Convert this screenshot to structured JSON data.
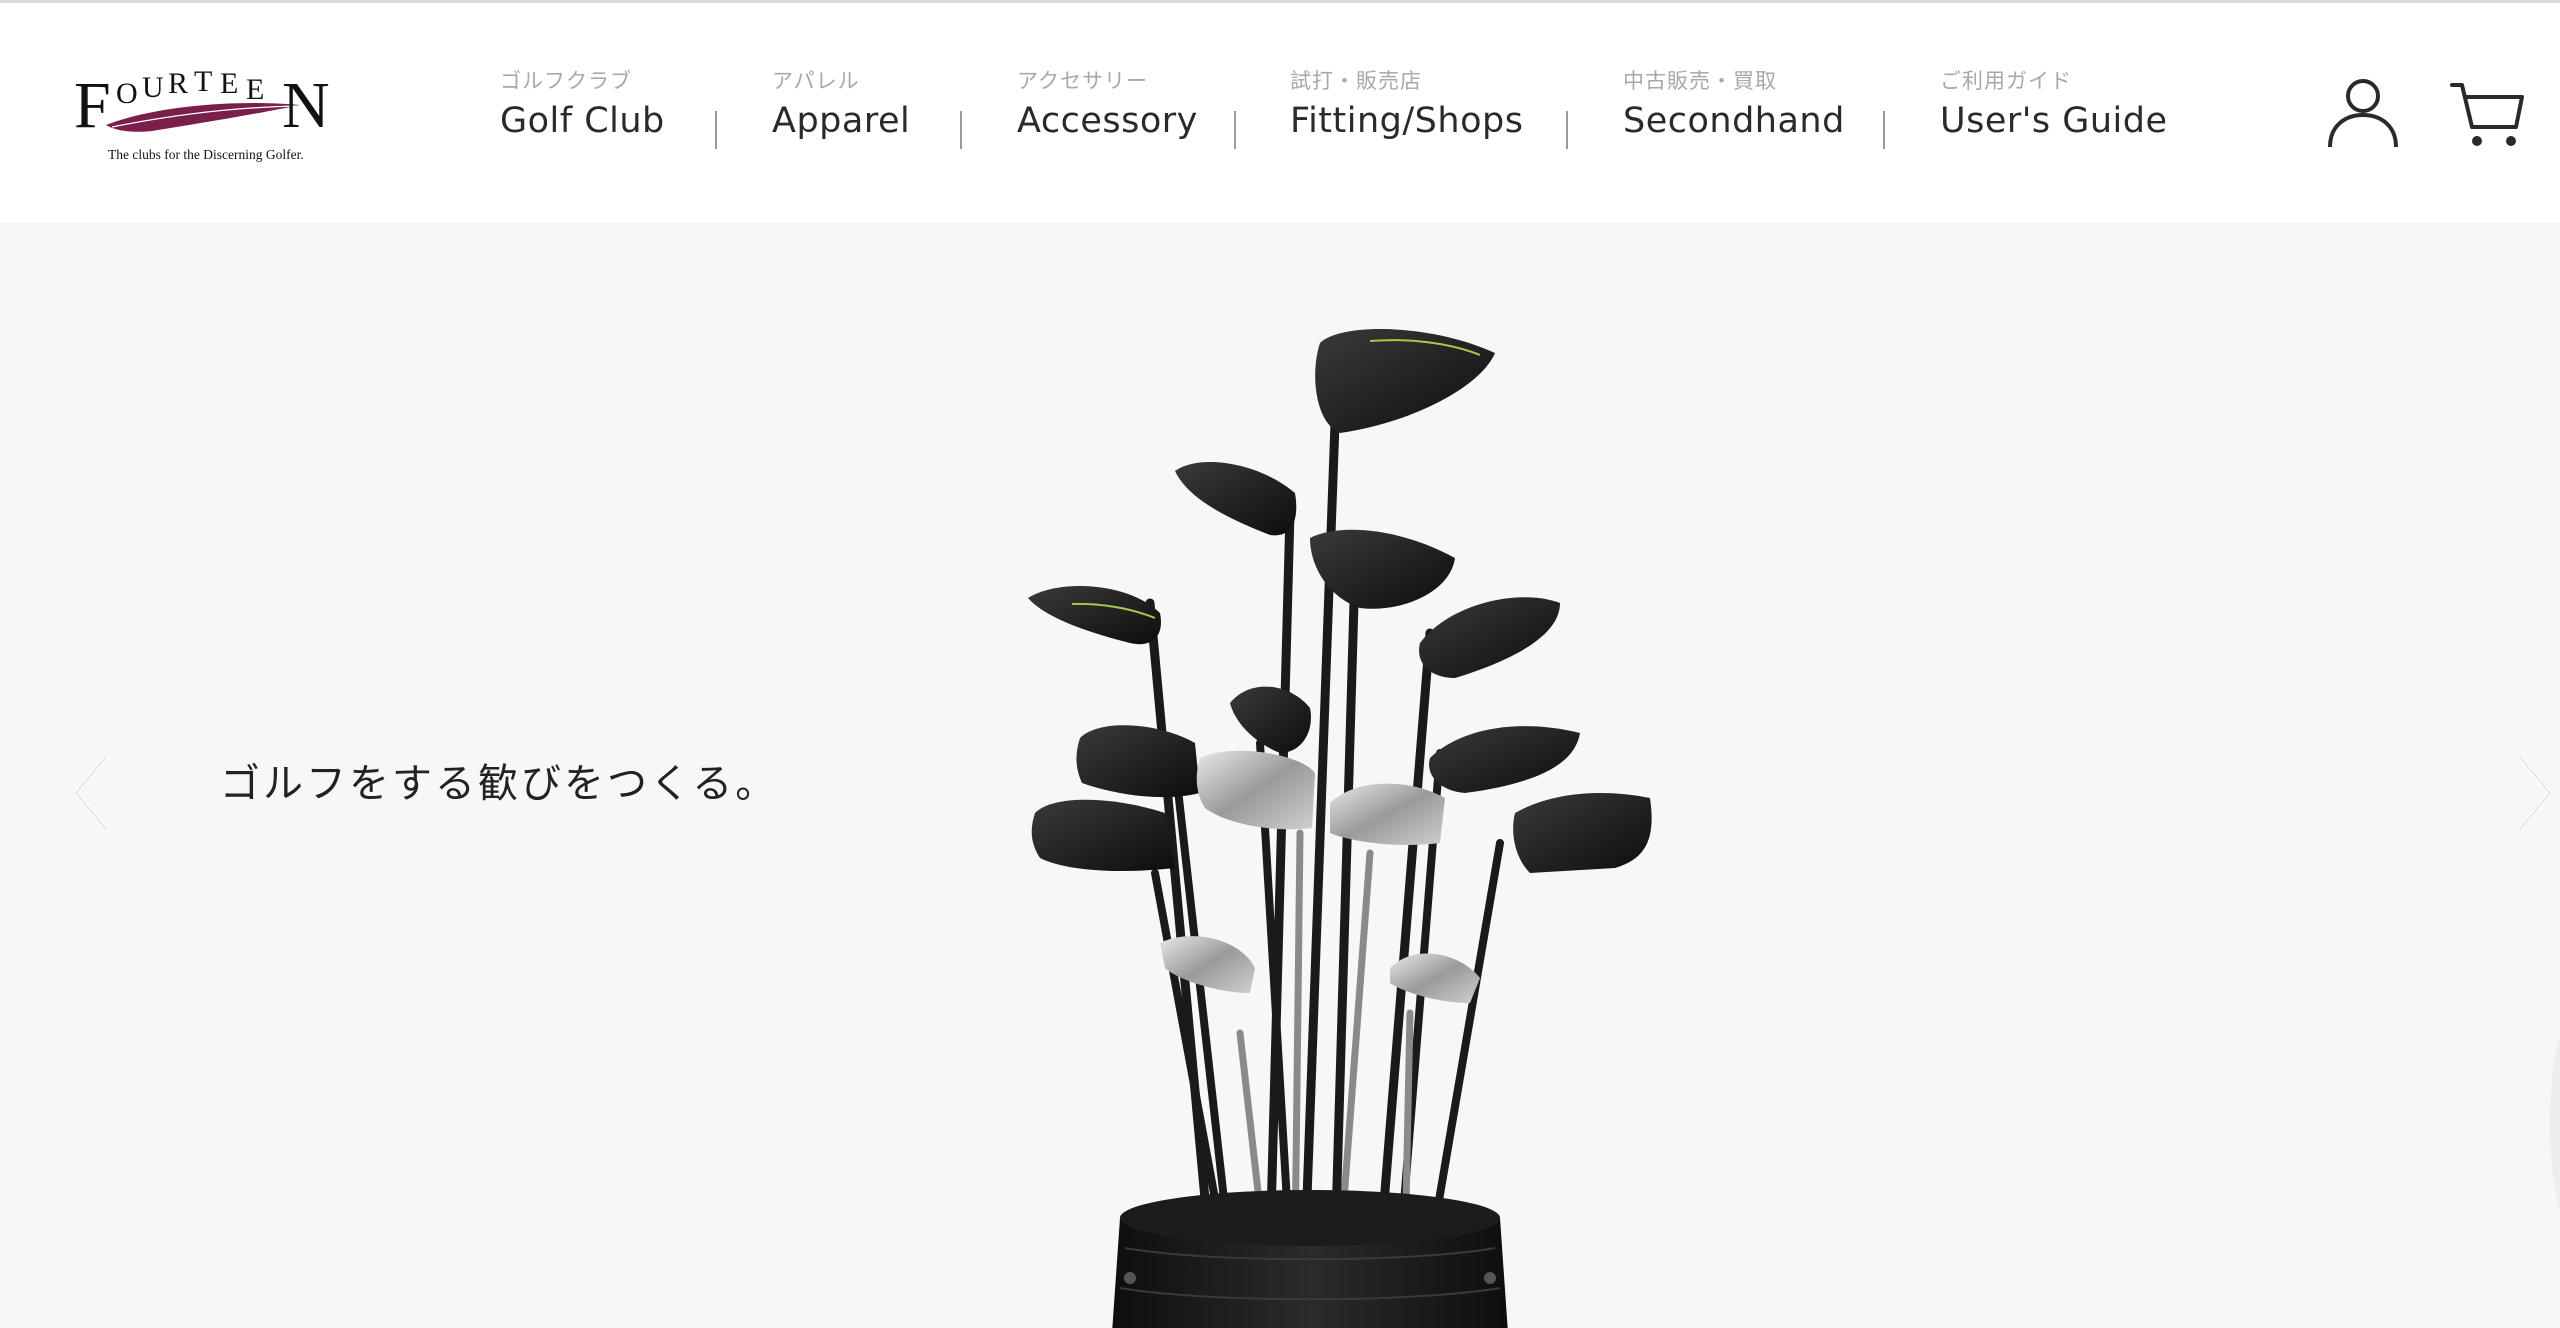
{
  "brand": {
    "name": "FOURTEEN",
    "tagline": "The clubs for the Discerning Golfer."
  },
  "nav": {
    "items": [
      {
        "jp": "ゴルフクラブ",
        "en": "Golf Club"
      },
      {
        "jp": "アパレル",
        "en": "Apparel"
      },
      {
        "jp": "アクセサリー",
        "en": "Accessory"
      },
      {
        "jp": "試打・販売店",
        "en": "Fitting/Shops"
      },
      {
        "jp": "中古販売・買取",
        "en": "Secondhand"
      },
      {
        "jp": "ご利用ガイド",
        "en": "User's Guide"
      }
    ]
  },
  "header_icons": {
    "account": "user-icon",
    "cart": "cart-icon"
  },
  "hero": {
    "tagline": "ゴルフをする歓びをつくる。",
    "prev_icon": "chevron-left-icon",
    "next_icon": "chevron-right-icon"
  },
  "colors": {
    "brand_accent": "#7a1f4a",
    "text": "#2a2a2a",
    "muted": "#a8a8a8",
    "hero_bg": "#f7f7f7"
  }
}
